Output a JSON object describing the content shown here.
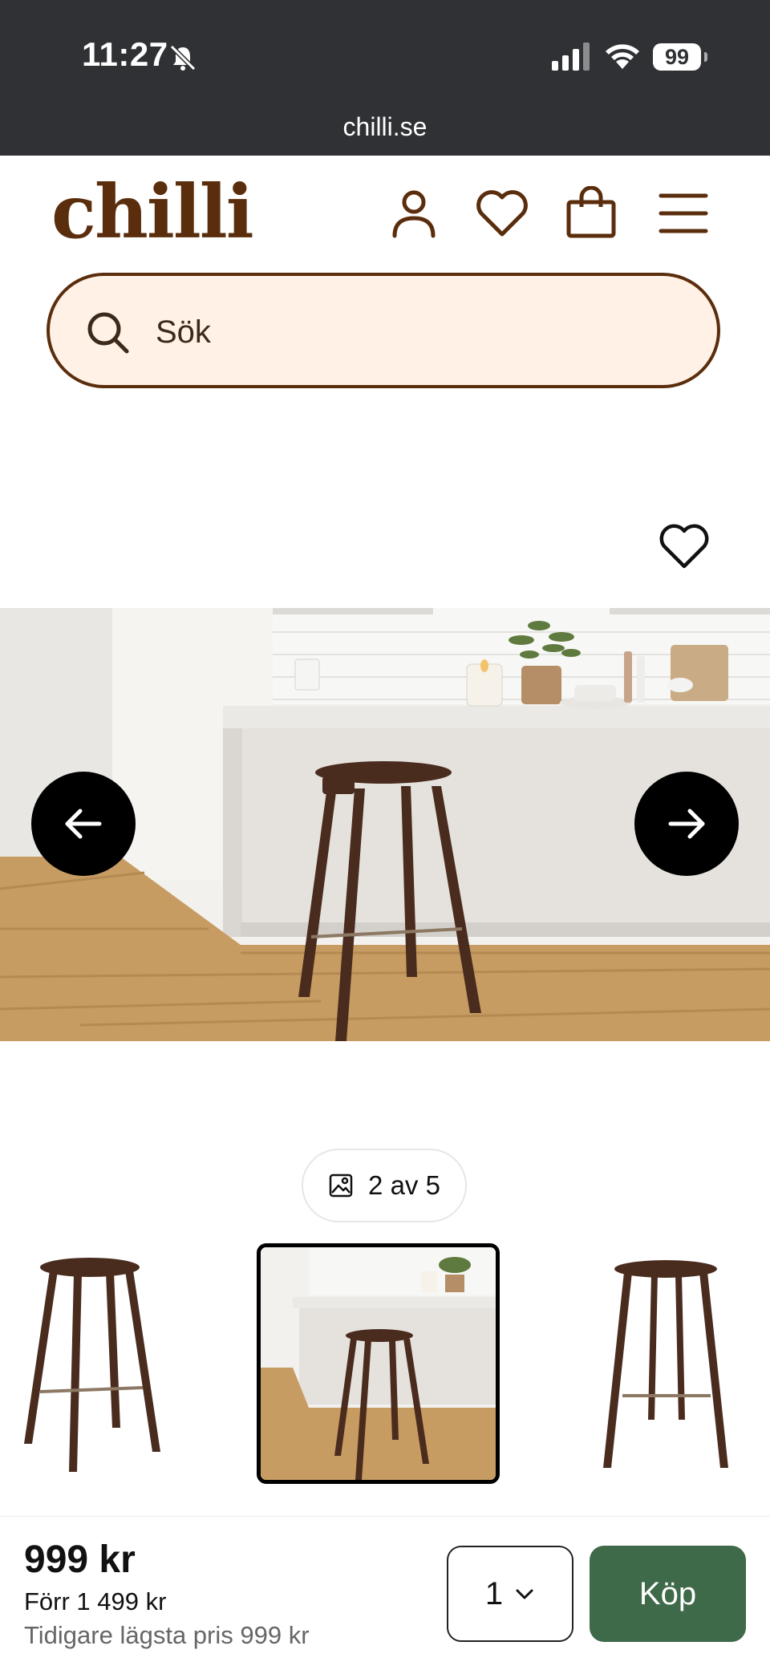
{
  "status_bar": {
    "time": "11:27",
    "battery": "99",
    "url": "chilli.se"
  },
  "header": {
    "logo": "chilli"
  },
  "search": {
    "placeholder": "Sök"
  },
  "gallery": {
    "counter": "2 av 5",
    "active_index": 2,
    "total": 5
  },
  "purchase": {
    "price": "999 kr",
    "before_price": "Förr 1 499 kr",
    "lowest_price": "Tidigare lägsta pris 999 kr",
    "quantity": "1",
    "buy_label": "Köp"
  },
  "colors": {
    "brand_brown": "#5a2d0c",
    "search_bg": "#fff1e5",
    "buy_green": "#3f6a49",
    "status_bar_bg": "#2f3134"
  }
}
